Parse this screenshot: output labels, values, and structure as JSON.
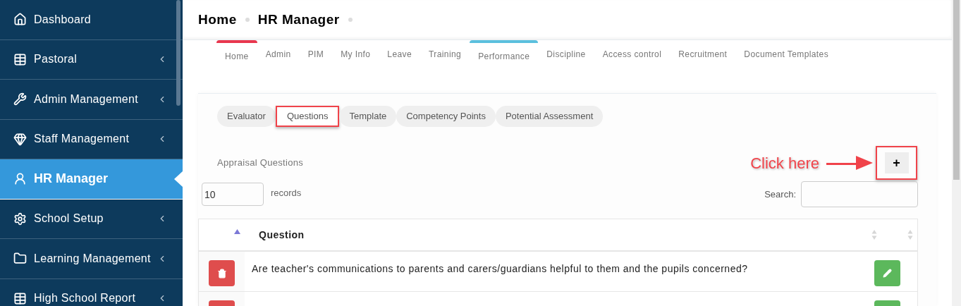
{
  "sidebar": {
    "items": [
      {
        "label": "Dashboard",
        "selected": false,
        "has_submenu": false
      },
      {
        "label": "Pastoral",
        "selected": false,
        "has_submenu": true
      },
      {
        "label": "Admin Management",
        "selected": false,
        "has_submenu": true
      },
      {
        "label": "Staff Management",
        "selected": false,
        "has_submenu": true
      },
      {
        "label": "HR Manager",
        "selected": true,
        "has_submenu": false
      },
      {
        "label": "School Setup",
        "selected": false,
        "has_submenu": true
      },
      {
        "label": "Learning Management",
        "selected": false,
        "has_submenu": true
      },
      {
        "label": "High School Report",
        "selected": false,
        "has_submenu": true
      }
    ]
  },
  "breadcrumb": [
    "Home",
    "HR Manager"
  ],
  "module_tabs": [
    {
      "label": "Home",
      "color": "#e8374e"
    },
    {
      "label": "Admin"
    },
    {
      "label": "PIM"
    },
    {
      "label": "My Info"
    },
    {
      "label": "Leave"
    },
    {
      "label": "Training"
    },
    {
      "label": "Performance",
      "color": "#5bc0de"
    },
    {
      "label": "Discipline"
    },
    {
      "label": "Access control"
    },
    {
      "label": "Recruitment"
    },
    {
      "label": "Document Templates"
    }
  ],
  "sub_tabs": [
    {
      "label": "Evaluator",
      "selected": false,
      "highlighted": false
    },
    {
      "label": "Questions",
      "selected": true,
      "highlighted": true
    },
    {
      "label": "Template",
      "selected": false,
      "highlighted": false
    },
    {
      "label": "Competency Points",
      "selected": false,
      "highlighted": false
    },
    {
      "label": "Potential Assessment",
      "selected": false,
      "highlighted": false
    }
  ],
  "section_title": "Appraisal Questions",
  "add_button": {
    "label": "+",
    "highlighted": true
  },
  "annotation": "Click here",
  "records": {
    "value": "10",
    "label": "records"
  },
  "search": {
    "label": "Search:"
  },
  "table": {
    "columns": [
      "Question"
    ],
    "rows": [
      {
        "question": "Are teacher's communications to parents and carers/guardians helpful to them and the pupils concerned?"
      },
      {}
    ]
  }
}
